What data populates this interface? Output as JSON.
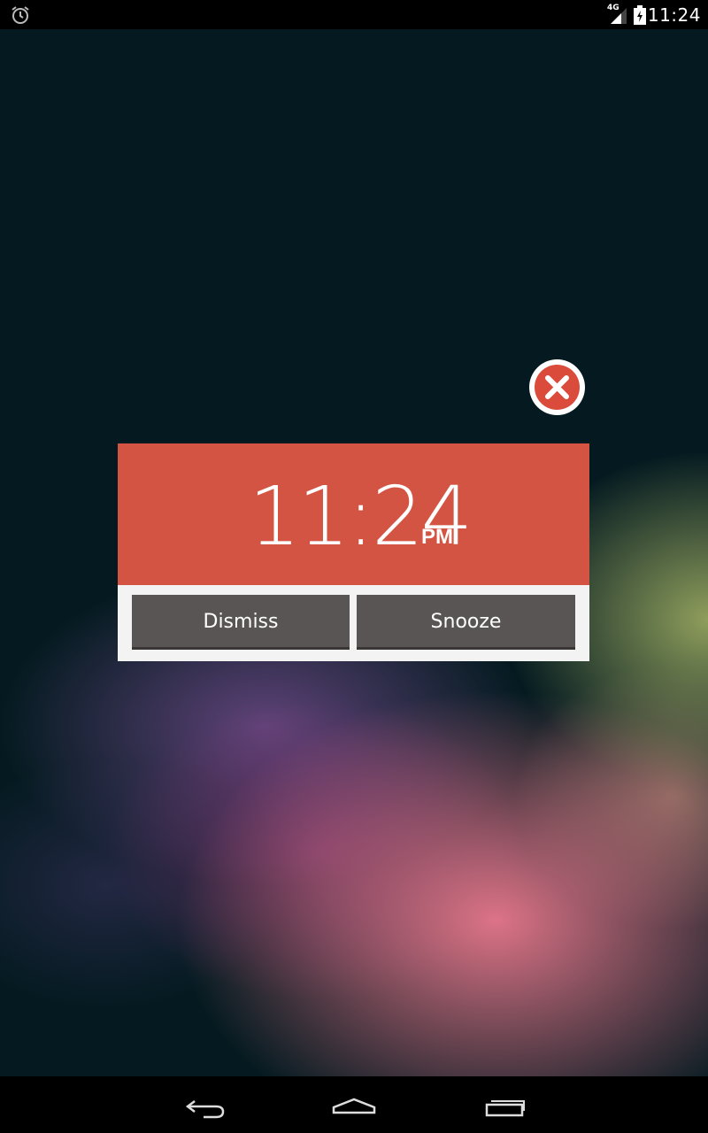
{
  "status_bar": {
    "network": "4G",
    "time": "11:24",
    "icons": [
      "alarm-icon",
      "signal-icon",
      "battery-charging-icon"
    ]
  },
  "alarm": {
    "time": "11:24",
    "ampm": "PM",
    "dismiss_label": "Dismiss",
    "snooze_label": "Snooze",
    "close_icon": "close-icon"
  },
  "nav_bar": {
    "icons": [
      "back-icon",
      "home-icon",
      "recent-apps-icon"
    ]
  },
  "colors": {
    "accent": "#d45443",
    "button_bg": "#5a5555",
    "card_bg": "#f3f3f3",
    "wallpaper_base": "#041a20"
  }
}
